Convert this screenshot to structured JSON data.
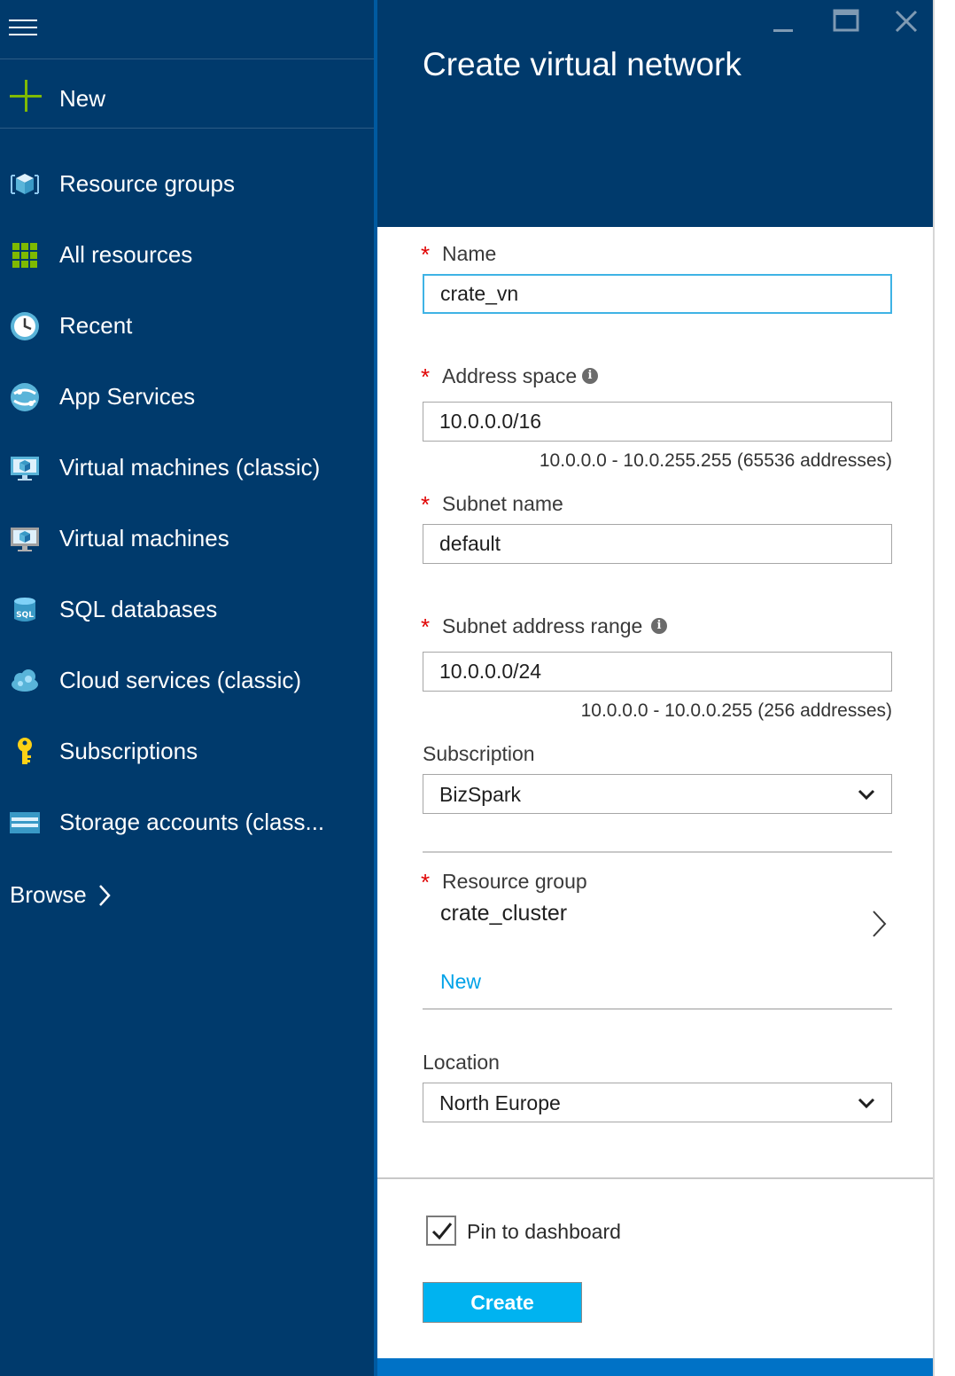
{
  "nav": {
    "new_label": "New",
    "items": [
      {
        "label": "Resource groups",
        "icon": "resource-groups-icon"
      },
      {
        "label": "All resources",
        "icon": "all-resources-icon"
      },
      {
        "label": "Recent",
        "icon": "clock-icon"
      },
      {
        "label": "App Services",
        "icon": "app-services-icon"
      },
      {
        "label": "Virtual machines (classic)",
        "icon": "vm-classic-icon"
      },
      {
        "label": "Virtual machines",
        "icon": "vm-icon"
      },
      {
        "label": "SQL databases",
        "icon": "sql-database-icon"
      },
      {
        "label": "Cloud services (classic)",
        "icon": "cloud-services-icon"
      },
      {
        "label": "Subscriptions",
        "icon": "key-icon"
      },
      {
        "label": "Storage accounts (class...",
        "icon": "storage-icon"
      }
    ],
    "browse_label": "Browse",
    "sql_icon_text": "SQL"
  },
  "blade": {
    "title": "Create virtual network",
    "name": {
      "label": "Name",
      "value": "crate_vn"
    },
    "address_space": {
      "label": "Address space",
      "value": "10.0.0.0/16",
      "hint": "10.0.0.0 - 10.0.255.255 (65536 addresses)"
    },
    "subnet_name": {
      "label": "Subnet name",
      "value": "default"
    },
    "subnet_range": {
      "label": "Subnet address range",
      "value": "10.0.0.0/24",
      "hint": "10.0.0.0 - 10.0.0.255 (256 addresses)"
    },
    "subscription": {
      "label": "Subscription",
      "value": "BizSpark"
    },
    "resource_group": {
      "label": "Resource group",
      "value": "crate_cluster",
      "new_link": "New"
    },
    "location": {
      "label": "Location",
      "value": "North Europe"
    },
    "pin": {
      "label": "Pin to dashboard",
      "checked": true
    },
    "create_label": "Create",
    "required_mark": "*",
    "info_glyph": "i"
  },
  "colors": {
    "nav_bg": "#003a6c",
    "accent": "#00b3f0",
    "link": "#00a2e8",
    "required": "#e00000",
    "focus": "#3fb3e5"
  }
}
